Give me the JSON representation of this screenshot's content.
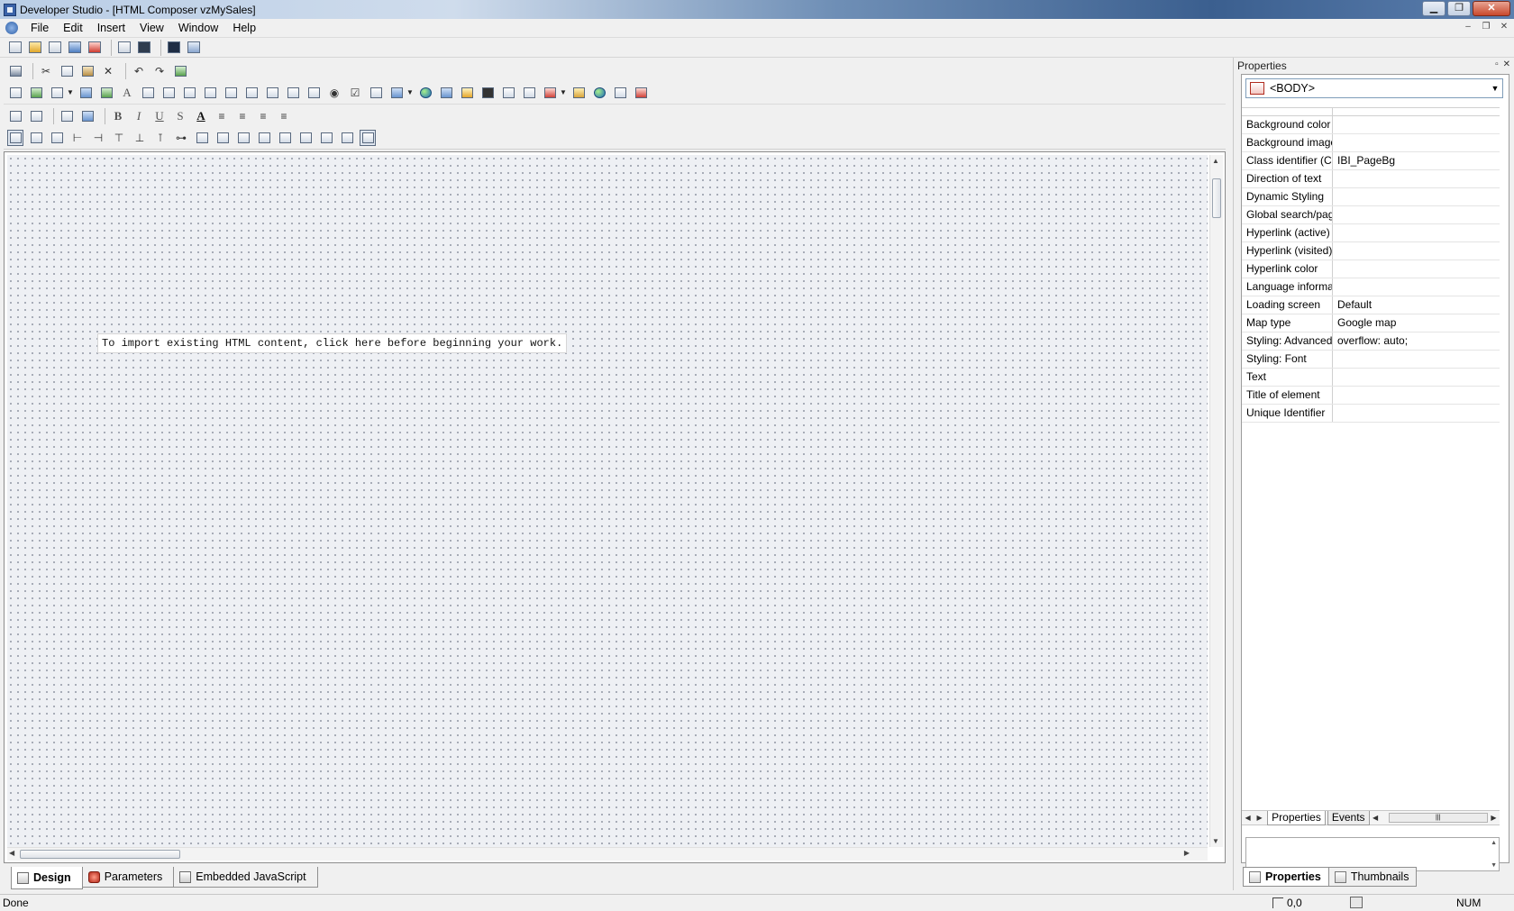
{
  "window": {
    "title": "Developer Studio - [HTML Composer vzMySales]",
    "controls": {
      "minimize": "▁",
      "maximize": "❐",
      "close": "✕"
    }
  },
  "menu": {
    "items": [
      "File",
      "Edit",
      "Insert",
      "View",
      "Window",
      "Help"
    ],
    "mdi_controls": {
      "minimize": "–",
      "restore": "❐",
      "close": "✕"
    }
  },
  "canvas": {
    "import_note": "To import existing HTML content, click here before beginning your work."
  },
  "editor_tabs": [
    "Design",
    "Parameters",
    "Embedded JavaScript"
  ],
  "format_toolbar": {
    "bold": "B",
    "italic": "I",
    "underline": "U",
    "strike": "S",
    "font_color": "A"
  },
  "properties": {
    "panel_title": "Properties",
    "selected_element": "<BODY>",
    "rows": [
      {
        "key": "Background color",
        "value": ""
      },
      {
        "key": "Background image",
        "value": ""
      },
      {
        "key": "Class identifier (CSS",
        "value": "IBI_PageBg"
      },
      {
        "key": "Direction of text",
        "value": ""
      },
      {
        "key": "Dynamic Styling",
        "value": ""
      },
      {
        "key": "Global search/pagin",
        "value": ""
      },
      {
        "key": "Hyperlink (active) co",
        "value": ""
      },
      {
        "key": "Hyperlink (visited) co",
        "value": ""
      },
      {
        "key": "Hyperlink color",
        "value": ""
      },
      {
        "key": "Language informatio",
        "value": ""
      },
      {
        "key": "Loading screen",
        "value": "Default"
      },
      {
        "key": "Map type",
        "value": "Google map"
      },
      {
        "key": "Styling: Advanced (C",
        "value": "overflow: auto;"
      },
      {
        "key": "Styling: Font",
        "value": ""
      },
      {
        "key": "Text",
        "value": ""
      },
      {
        "key": "Title of element",
        "value": ""
      },
      {
        "key": "Unique Identifier",
        "value": ""
      }
    ],
    "inner_tabs": [
      "Properties",
      "Events"
    ],
    "panel_tabs": [
      "Properties",
      "Thumbnails"
    ]
  },
  "status": {
    "text": "Done",
    "coords": "0,0",
    "num": "NUM"
  }
}
